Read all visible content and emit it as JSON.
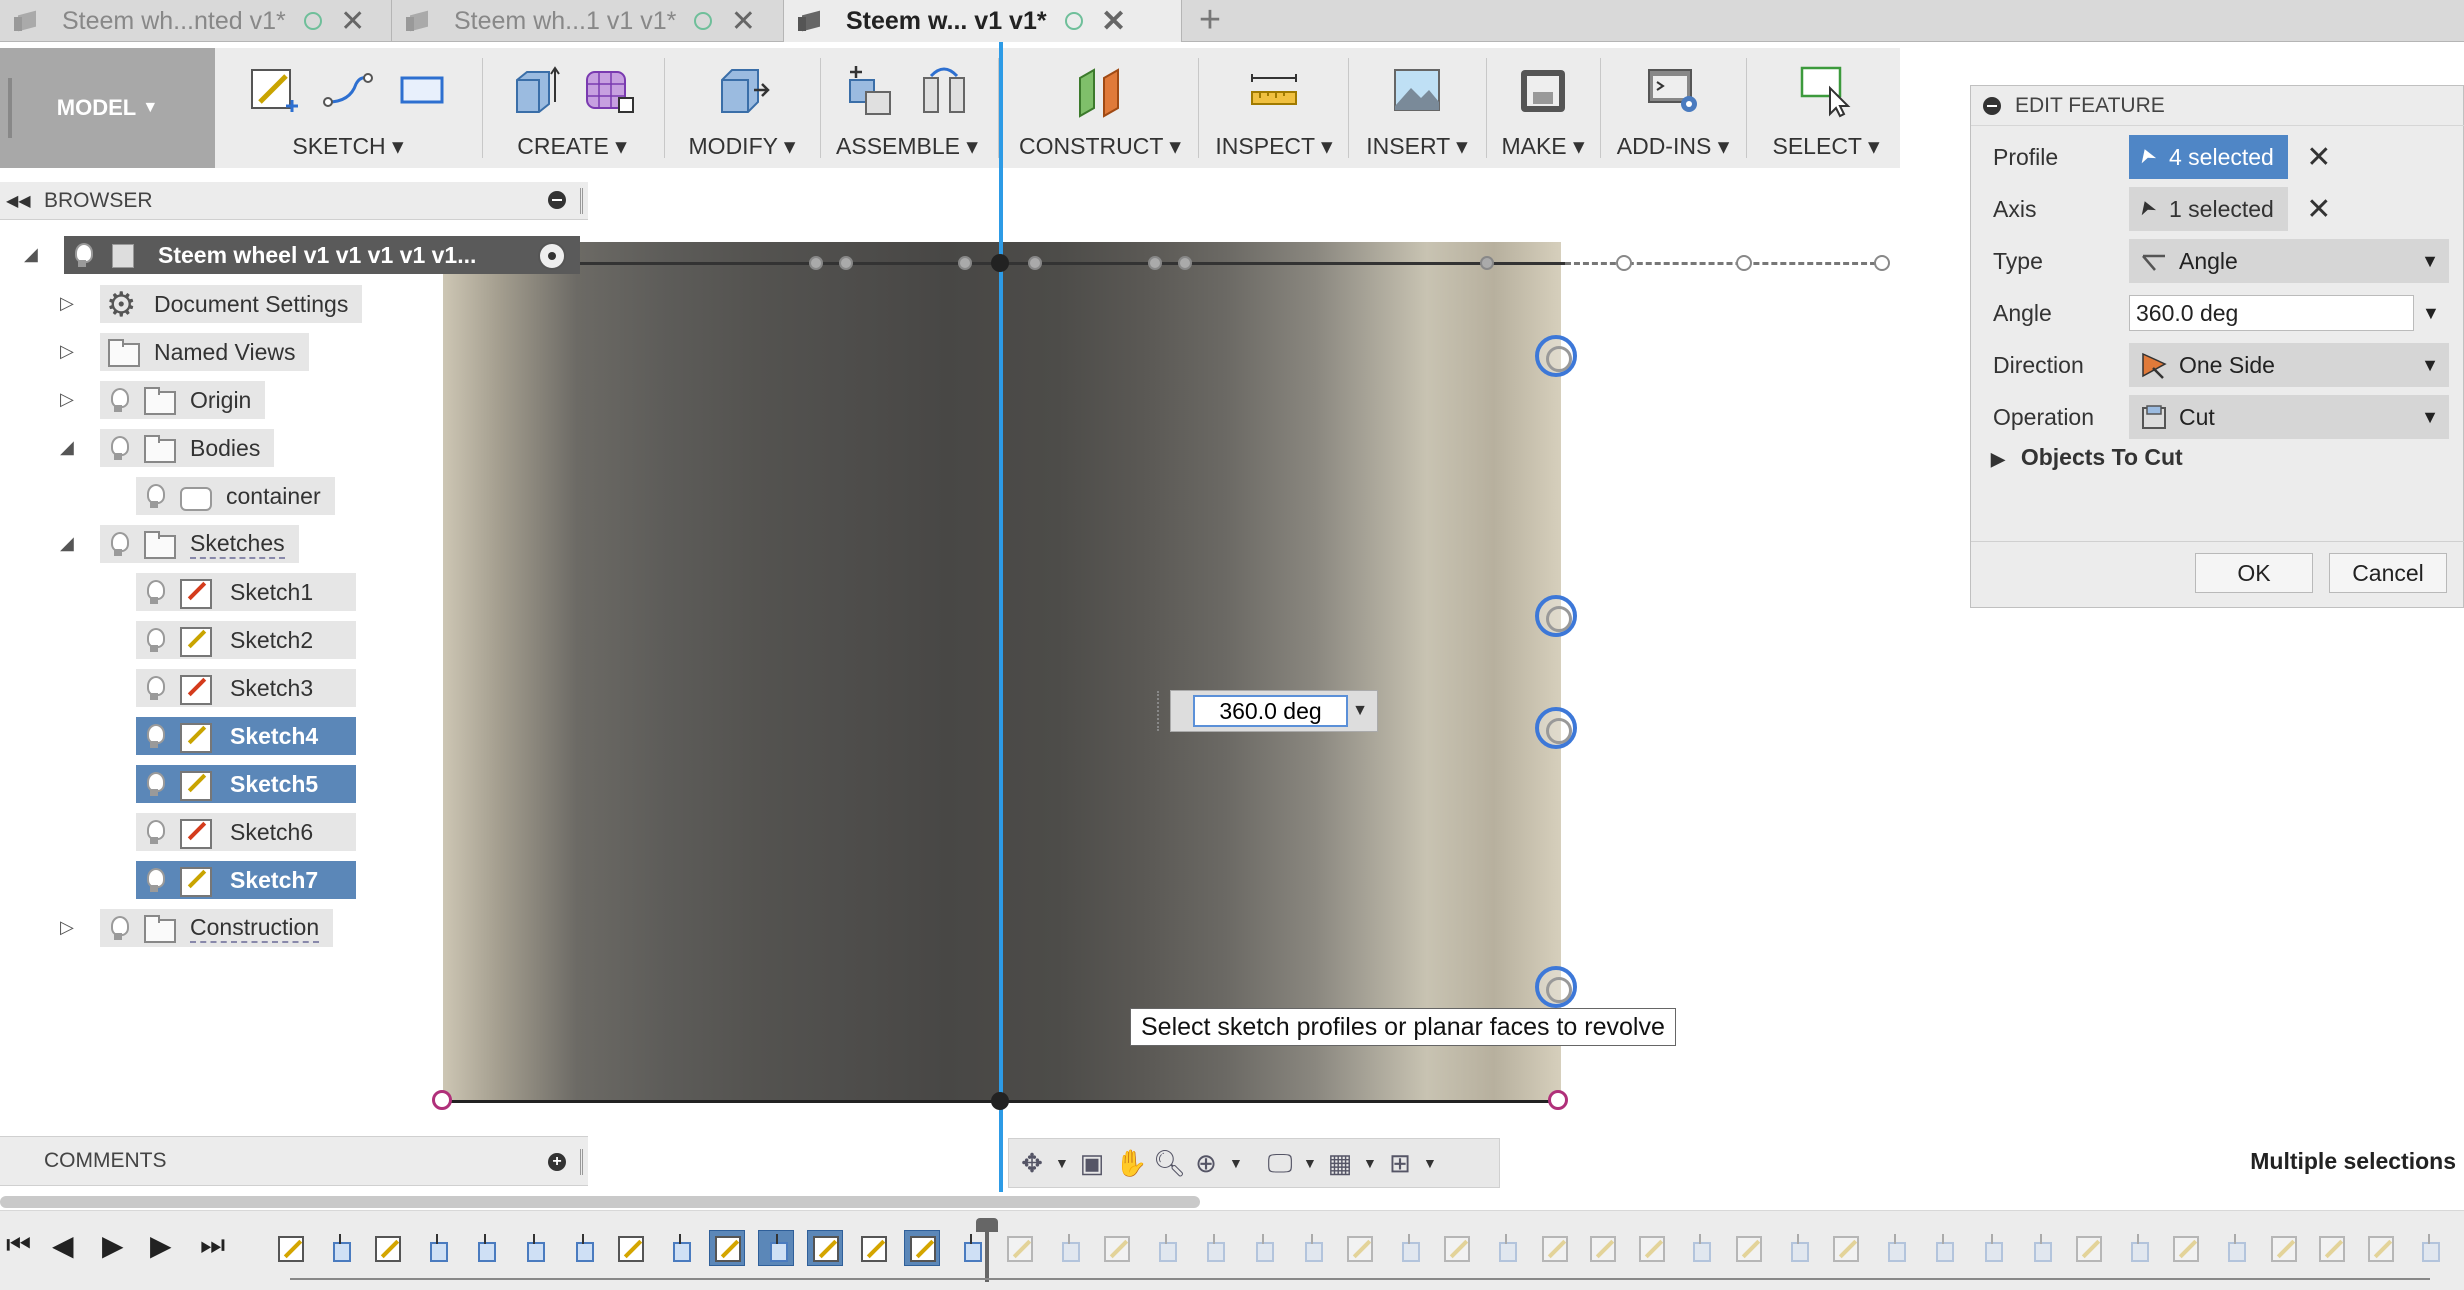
{
  "tabs": [
    {
      "title": "Steem wh...nted v1*",
      "active": false
    },
    {
      "title": "Steem wh...1 v1 v1*",
      "active": false
    },
    {
      "title": "Steem w... v1 v1*",
      "active": true
    }
  ],
  "toolbar": {
    "workspace": "MODEL",
    "groups": [
      {
        "label": "SKETCH",
        "icons": [
          "create-sketch-icon",
          "line-icon",
          "rectangle-icon"
        ]
      },
      {
        "label": "CREATE",
        "icons": [
          "extrude-icon",
          "form-icon"
        ]
      },
      {
        "label": "MODIFY",
        "icons": [
          "press-pull-icon"
        ]
      },
      {
        "label": "ASSEMBLE",
        "icons": [
          "new-component-icon",
          "joint-icon"
        ]
      },
      {
        "label": "CONSTRUCT",
        "icons": [
          "offset-plane-icon"
        ]
      },
      {
        "label": "INSPECT",
        "icons": [
          "measure-icon"
        ]
      },
      {
        "label": "INSERT",
        "icons": [
          "insert-image-icon"
        ]
      },
      {
        "label": "MAKE",
        "icons": [
          "3d-print-icon"
        ]
      },
      {
        "label": "ADD-INS",
        "icons": [
          "scripts-icon"
        ]
      },
      {
        "label": "SELECT",
        "icons": [
          "select-icon"
        ]
      }
    ]
  },
  "browser": {
    "title": "BROWSER",
    "root": "Steem wheel v1 v1 v1 v1 v1...",
    "items": [
      {
        "label": "Document Settings",
        "icon": "gear-icon"
      },
      {
        "label": "Named Views",
        "icon": "folder-icon"
      },
      {
        "label": "Origin",
        "icon": "folder-icon"
      },
      {
        "label": "Bodies",
        "icon": "folder-icon"
      },
      {
        "label": "container",
        "icon": "body-icon"
      },
      {
        "label": "Sketches",
        "icon": "folder-icon"
      },
      {
        "label": "Sketch1",
        "icon": "sketch-icon",
        "selected": false
      },
      {
        "label": "Sketch2",
        "icon": "sketch-icon",
        "selected": false
      },
      {
        "label": "Sketch3",
        "icon": "sketch-icon",
        "selected": false
      },
      {
        "label": "Sketch4",
        "icon": "sketch-icon",
        "selected": true
      },
      {
        "label": "Sketch5",
        "icon": "sketch-icon",
        "selected": true
      },
      {
        "label": "Sketch6",
        "icon": "sketch-icon",
        "selected": false
      },
      {
        "label": "Sketch7",
        "icon": "sketch-icon",
        "selected": true
      },
      {
        "label": "Construction",
        "icon": "folder-icon"
      }
    ]
  },
  "canvas": {
    "angle_value": "360.0 deg",
    "tooltip": "Select sketch profiles or planar faces to revolve"
  },
  "dialog": {
    "title": "EDIT FEATURE",
    "profile_label": "Profile",
    "profile_value": "4 selected",
    "axis_label": "Axis",
    "axis_value": "1 selected",
    "type_label": "Type",
    "type_value": "Angle",
    "angle_label": "Angle",
    "angle_value": "360.0 deg",
    "direction_label": "Direction",
    "direction_value": "One Side",
    "operation_label": "Operation",
    "operation_value": "Cut",
    "objects_label": "Objects To Cut",
    "ok_label": "OK",
    "cancel_label": "Cancel"
  },
  "comments": {
    "title": "COMMENTS"
  },
  "status": "Multiple selections",
  "colors": {
    "accent": "#2d9be6",
    "selection": "#5b87b8",
    "manipulator": "#3d78d8"
  }
}
